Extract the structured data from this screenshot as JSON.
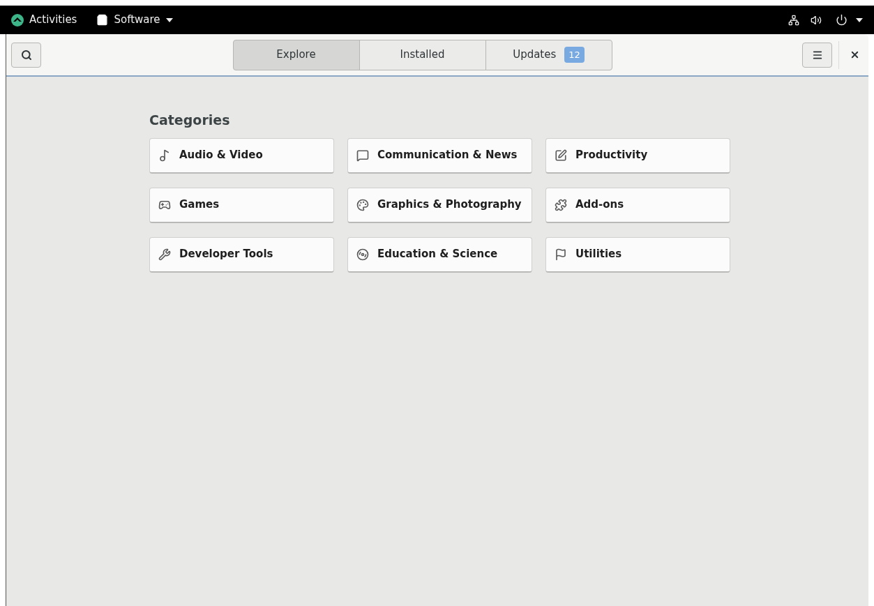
{
  "top_bar": {
    "activities": "Activities",
    "app_menu": "Software"
  },
  "header": {
    "tabs": [
      {
        "label": "Explore",
        "selected": true
      },
      {
        "label": "Installed",
        "selected": false
      },
      {
        "label": "Updates",
        "selected": false,
        "badge": "12"
      }
    ]
  },
  "categories": {
    "title": "Categories",
    "items": [
      {
        "label": "Audio & Video"
      },
      {
        "label": "Communication & News"
      },
      {
        "label": "Productivity"
      },
      {
        "label": "Games"
      },
      {
        "label": "Graphics & Photography"
      },
      {
        "label": "Add-ons"
      },
      {
        "label": "Developer Tools"
      },
      {
        "label": "Education & Science"
      },
      {
        "label": "Utilities"
      }
    ]
  }
}
